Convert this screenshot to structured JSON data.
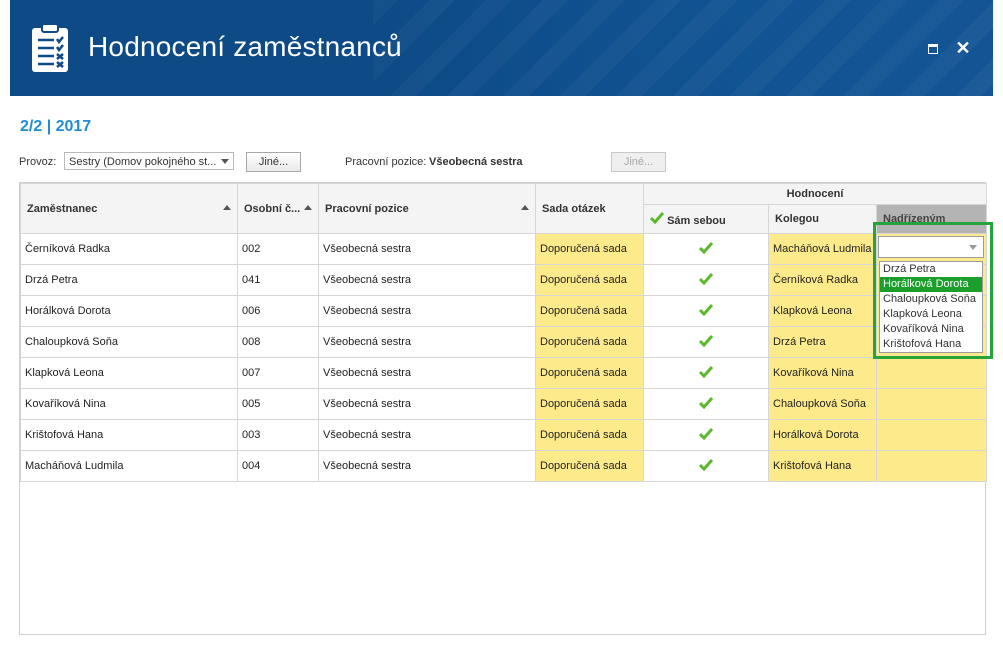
{
  "window": {
    "title": "Hodnocení zaměstnanců",
    "maximize_label": "",
    "close_label": "✕"
  },
  "period": "2/2 | 2017",
  "filters": {
    "provoz_label": "Provoz:",
    "provoz_value": "Sestry (Domov pokojného st...",
    "provoz_other_button": "Jiné...",
    "position_label": "Pracovní pozice:",
    "position_value": "Všeobecná sestra",
    "position_other_button": "Jiné..."
  },
  "table": {
    "columns": {
      "employee": "Zaměstnanec",
      "personal_no": "Osobní č...",
      "job_position": "Pracovní pozice",
      "question_set": "Sada otázek",
      "rating_group": "Hodnocení",
      "self": "Sám sebou",
      "colleague": "Kolegou",
      "superior": "Nadřízeným"
    },
    "rows": [
      {
        "employee": "Černíková Radka",
        "no": "002",
        "position": "Všeobecná sestra",
        "set": "Doporučená sada",
        "colleague": "Macháňová Ludmila"
      },
      {
        "employee": "Drzá Petra",
        "no": "041",
        "position": "Všeobecná sestra",
        "set": "Doporučená sada",
        "colleague": "Černíková Radka"
      },
      {
        "employee": "Horálková Dorota",
        "no": "006",
        "position": "Všeobecná sestra",
        "set": "Doporučená sada",
        "colleague": "Klapková Leona"
      },
      {
        "employee": "Chaloupková Soňa",
        "no": "008",
        "position": "Všeobecná sestra",
        "set": "Doporučená sada",
        "colleague": "Drzá Petra"
      },
      {
        "employee": "Klapková Leona",
        "no": "007",
        "position": "Všeobecná sestra",
        "set": "Doporučená sada",
        "colleague": "Kovaříková Nina"
      },
      {
        "employee": "Kovaříková Nina",
        "no": "005",
        "position": "Všeobecná sestra",
        "set": "Doporučená sada",
        "colleague": "Chaloupková Soňa"
      },
      {
        "employee": "Krištofová Hana",
        "no": "003",
        "position": "Všeobecná sestra",
        "set": "Doporučená sada",
        "colleague": "Horálková Dorota"
      },
      {
        "employee": "Macháňová Ludmila",
        "no": "004",
        "position": "Všeobecná sestra",
        "set": "Doporučená sada",
        "colleague": "Krištofová Hana"
      }
    ]
  },
  "superior_dropdown": {
    "value": "",
    "options": [
      "Drzá Petra",
      "Horálková Dorota",
      "Chaloupková Soňa",
      "Klapková Leona",
      "Kovaříková Nina",
      "Krištofová Hana"
    ],
    "highlighted": "Horálková Dorota"
  },
  "colors": {
    "title_bar": "#0d4a86",
    "period": "#1f8dd0",
    "question_set_bg": "#fdea8a",
    "check": "#5cb82e",
    "focus_frame": "#27a33c",
    "dropdown_highlight": "#1b9e2c"
  },
  "icons": {
    "app": "clipboard-checklist-icon",
    "self_header": "checkmark-icon",
    "cell": "checkmark-icon"
  }
}
